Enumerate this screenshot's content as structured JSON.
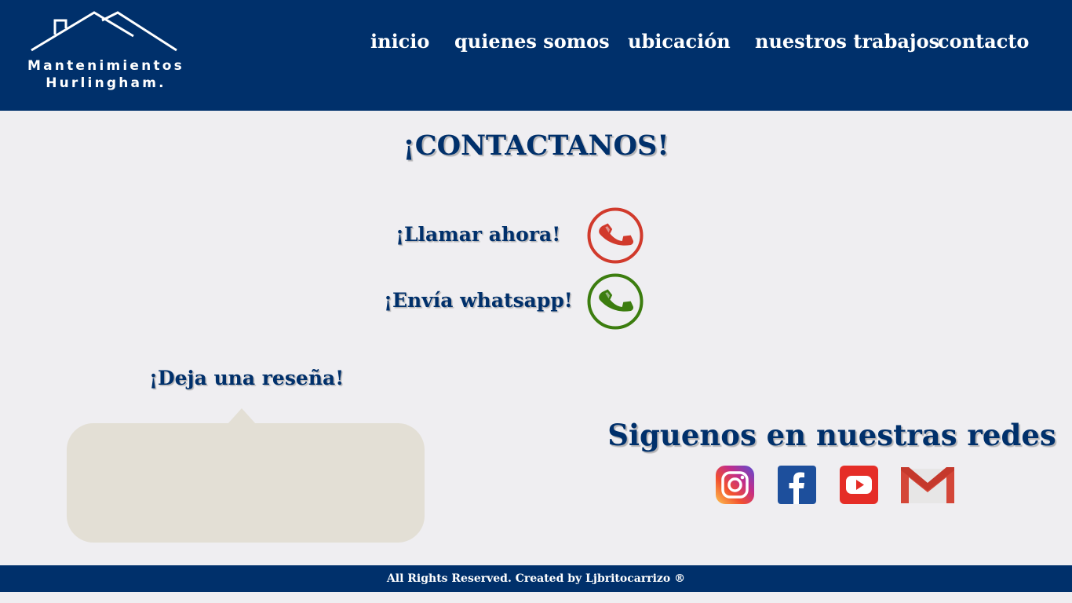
{
  "brand": {
    "line1": "Mantenimientos",
    "line2": "Hurlingham.",
    "logo_icon": "house-roof-icon"
  },
  "nav": {
    "items": [
      {
        "label": "inicio"
      },
      {
        "label": "quienes somos"
      },
      {
        "label": "ubicación"
      },
      {
        "label": "nuestros trabajos"
      },
      {
        "label": "contacto"
      }
    ]
  },
  "main": {
    "title": "¡CONTACTANOS!",
    "call": {
      "label": "¡Llamar ahora!",
      "icon": "phone-icon",
      "color": "#d13a2c"
    },
    "whatsapp": {
      "label": "¡Envía whatsapp!",
      "icon": "phone-icon",
      "color": "#3c7d0f"
    }
  },
  "review": {
    "title": "¡Deja una reseña!"
  },
  "social": {
    "title": "Siguenos en nuestras redes",
    "icons": [
      "instagram-icon",
      "facebook-icon",
      "youtube-icon",
      "gmail-icon"
    ]
  },
  "footer": {
    "text": "All Rights Reserved. Created by Ljbritocarrizo ®"
  },
  "colors": {
    "primary": "#00306b",
    "background": "#efeef1",
    "review_box": "#e3dfd5"
  }
}
